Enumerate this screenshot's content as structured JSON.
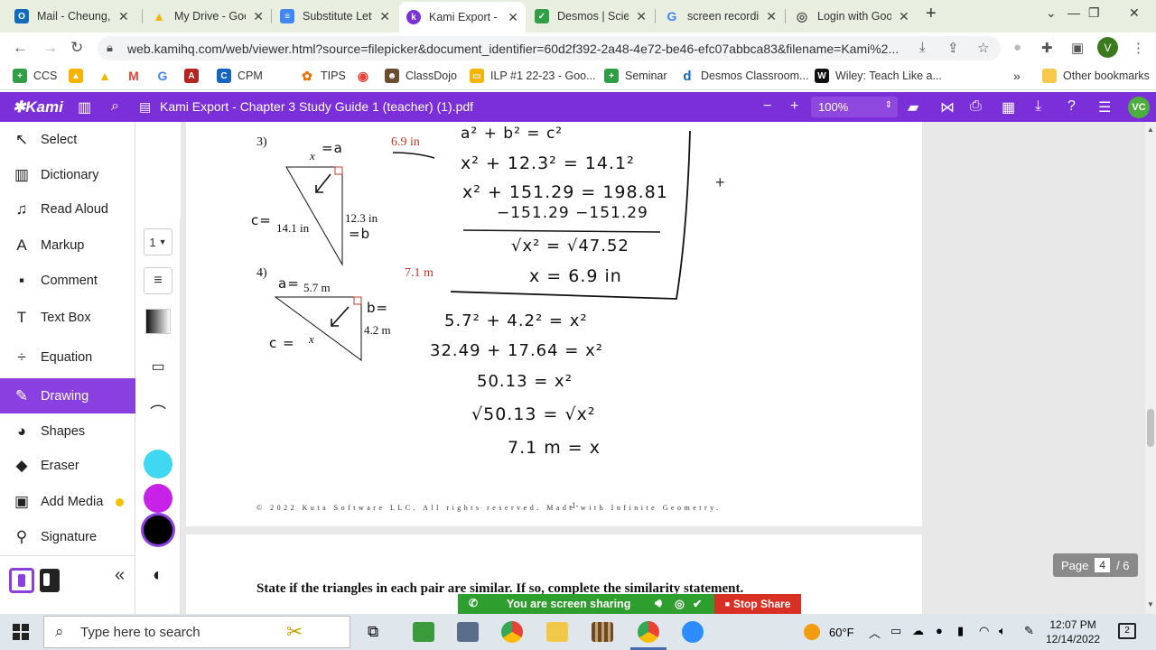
{
  "tabs": [
    {
      "title": "Mail - Cheung,",
      "color": "#0f6cbd",
      "glyph": "O"
    },
    {
      "title": "My Drive - Goo",
      "color": "#f4b400",
      "glyph": "▲"
    },
    {
      "title": "Substitute Lett",
      "color": "#4285f4",
      "glyph": "≡"
    },
    {
      "title": "Kami Export - C",
      "color": "#7b2fd8",
      "glyph": "k"
    },
    {
      "title": "Desmos | Scie",
      "color": "#2f9e44",
      "glyph": "✓"
    },
    {
      "title": "screen recordi",
      "color": "#ffffff",
      "glyph": "G"
    },
    {
      "title": "Login with Goo",
      "color": "#ffffff",
      "glyph": "◎"
    }
  ],
  "url": "web.kamihq.com/web/viewer.html?source=filepicker&document_identifier=60d2f392-2a48-4e72-be46-efc07abbca83&filename=Kami%2...",
  "profile_initial": "V",
  "bookmarks": [
    {
      "label": "CCS",
      "color": "#2f9e44",
      "glyph": "+"
    },
    {
      "label": "",
      "color": "#f4b400",
      "glyph": "▲"
    },
    {
      "label": "",
      "color": "#ea4335",
      "glyph": "M"
    },
    {
      "label": "",
      "color": "#4285f4",
      "glyph": "G"
    },
    {
      "label": "",
      "color": "#b3261e",
      "glyph": "A"
    },
    {
      "label": "CPM",
      "color": "#1565c0",
      "glyph": "C"
    },
    {
      "label": "TIPS",
      "color": "#e8710a",
      "glyph": "✿"
    },
    {
      "label": "",
      "color": "#ea4335",
      "glyph": "G"
    },
    {
      "label": "ClassDojo",
      "color": "#6a4c2e",
      "glyph": "☻"
    },
    {
      "label": "ILP #1 22-23 - Goo...",
      "color": "#f4b400",
      "glyph": "▭"
    },
    {
      "label": "Seminar",
      "color": "#2f9e44",
      "glyph": "+"
    },
    {
      "label": "Desmos Classroom...",
      "color": "#1565c0",
      "glyph": "d"
    },
    {
      "label": "Wiley: Teach Like a...",
      "color": "#111111",
      "glyph": "W"
    }
  ],
  "other_bookmarks": "Other bookmarks",
  "kami": {
    "logo": "✱Kami",
    "doc_title": "Kami Export - Chapter 3 Study Guide 1 (teacher) (1).pdf",
    "zoom": "100%",
    "user_initials": "VC"
  },
  "tools": [
    {
      "label": "Select",
      "icon": "↖"
    },
    {
      "label": "Dictionary",
      "icon": "▥"
    },
    {
      "label": "Read Aloud",
      "icon": "♫"
    },
    {
      "label": "Markup",
      "icon": "A"
    },
    {
      "label": "Comment",
      "icon": "▪"
    },
    {
      "label": "Text Box",
      "icon": "T"
    },
    {
      "label": "Equation",
      "icon": "÷"
    },
    {
      "label": "Drawing",
      "icon": "✎"
    },
    {
      "label": "Shapes",
      "icon": "◕"
    },
    {
      "label": "Eraser",
      "icon": "◆"
    },
    {
      "label": "Add Media",
      "icon": "▣"
    },
    {
      "label": "Signature",
      "icon": "⚲"
    }
  ],
  "drawing": {
    "pen_size": "1",
    "colors": [
      "#40d8f0",
      "#c822e8",
      "#000000"
    ]
  },
  "document": {
    "q3_num": "3)",
    "q3_answer": "6.9 in",
    "q3_side_x": "x",
    "q3_side_a": "12.3 in",
    "q3_side_c": "14.1 in",
    "q4_num": "4)",
    "q4_answer": "7.1 m",
    "q4_side_a": "5.7 m",
    "q4_side_b": "4.2 m",
    "q4_side_x": "x",
    "hw_q3": [
      "a² + b² = c²",
      "x² + 12.3² = 14.1²",
      "x² + 151.29 = 198.81",
      "−151.29  −151.29",
      "√x² = √47.52",
      "x = 6.9 in"
    ],
    "hw_q3_labels": [
      "=a",
      "c=",
      "=b"
    ],
    "hw_q4": [
      "5.7² + 4.2² = x²",
      "32.49 + 17.64 = x²",
      "50.13 = x²",
      "√50.13 = √x²",
      "7.1 m = x"
    ],
    "hw_q4_labels": [
      "a=",
      "b=",
      "c ="
    ],
    "footer": "© 2022 Kuta Software LLC. All rights reserved. Made with Infinite Geometry.",
    "page_number": "-1-",
    "next_heading": "State if the triangles in each pair are similar.  If so, complete the similarity statement."
  },
  "page_indicator": {
    "label": "Page",
    "current": "4",
    "total": "/ 6"
  },
  "screen_share": {
    "text": "You are screen sharing",
    "stop": "Stop Share"
  },
  "taskbar": {
    "search_placeholder": "Type here to search",
    "weather": "60°F",
    "time": "12:07 PM",
    "date": "12/14/2022",
    "notifications": "2"
  }
}
